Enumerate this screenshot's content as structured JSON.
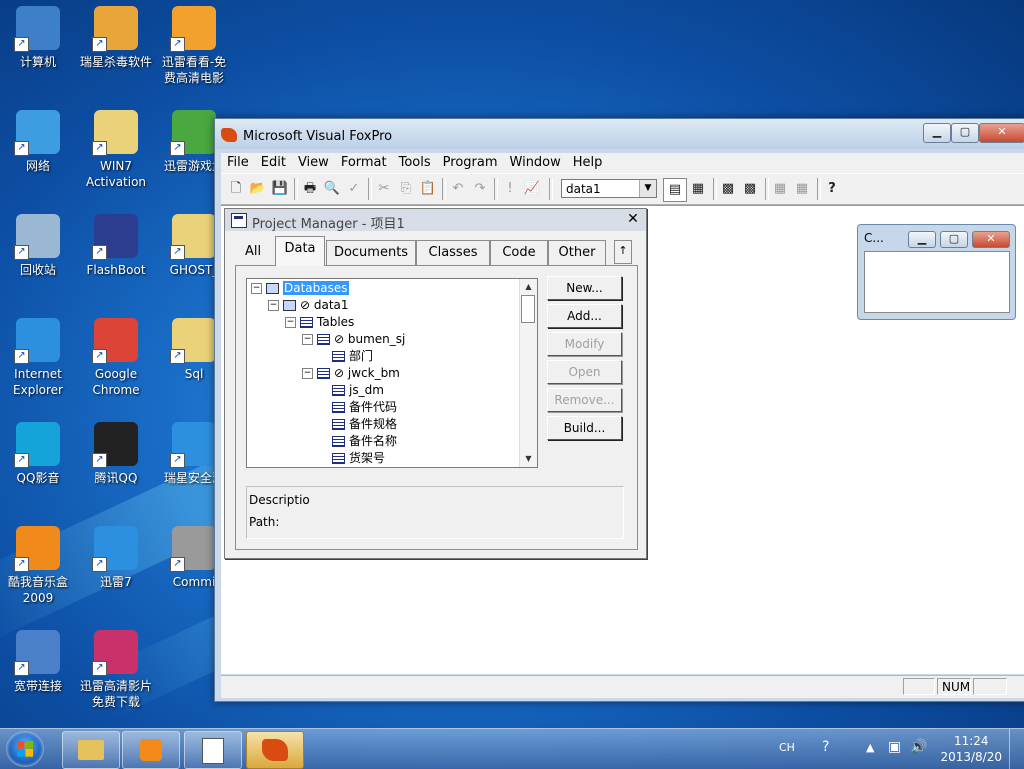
{
  "desktop": {
    "icons": [
      {
        "label": "计算机",
        "color": "#3d7fc9"
      },
      {
        "label": "瑞星杀毒软件",
        "color": "#e8a53a"
      },
      {
        "label": "迅雷看看-免费高清电影",
        "color": "#f2a22c"
      },
      {
        "label": "网络",
        "color": "#3d9de0"
      },
      {
        "label": "WIN7 Activation",
        "color": "#e9d279"
      },
      {
        "label": "迅雷游戏盒",
        "color": "#4aa840"
      },
      {
        "label": "回收站",
        "color": "#9ab8d4"
      },
      {
        "label": "FlashBoot",
        "color": "#2c3d8f"
      },
      {
        "label": "GHOST_",
        "color": "#e9d279"
      },
      {
        "label": "Internet Explorer",
        "color": "#2d8fe0"
      },
      {
        "label": "Google Chrome",
        "color": "#db4437"
      },
      {
        "label": "Sql",
        "color": "#e9d279"
      },
      {
        "label": "QQ影音",
        "color": "#16a3d9"
      },
      {
        "label": "腾讯QQ",
        "color": "#222222"
      },
      {
        "label": "瑞星安全浏",
        "color": "#2d8fe0"
      },
      {
        "label": "酷我音乐盒 2009",
        "color": "#f08a1a"
      },
      {
        "label": "迅雷7",
        "color": "#2d8fe0"
      },
      {
        "label": "Commi",
        "color": "#9a9a9a"
      },
      {
        "label": "宽带连接",
        "color": "#4a7fc9"
      },
      {
        "label": "迅雷高清影片免费下载",
        "color": "#c9316b"
      }
    ]
  },
  "window": {
    "title": "Microsoft Visual FoxPro",
    "menu": [
      "File",
      "Edit",
      "View",
      "Format",
      "Tools",
      "Program",
      "Window",
      "Help"
    ],
    "toolbar_combo": "data1",
    "status": {
      "num": "NUM"
    }
  },
  "project_manager": {
    "title": "Project Manager - 项目1",
    "tabs": [
      "All",
      "Data",
      "Documents",
      "Classes",
      "Code",
      "Other"
    ],
    "active_tab": "Data",
    "tree": [
      {
        "label": "Databases",
        "level": 0,
        "expander": "−",
        "icon": "db",
        "selected": true
      },
      {
        "label": "⊘ data1",
        "level": 1,
        "expander": "−",
        "icon": "db"
      },
      {
        "label": "Tables",
        "level": 2,
        "expander": "−",
        "icon": "table"
      },
      {
        "label": "⊘ bumen_sj",
        "level": 3,
        "expander": "−",
        "icon": "table"
      },
      {
        "label": "部门",
        "level": 4,
        "icon": "field"
      },
      {
        "label": "⊘ jwck_bm",
        "level": 3,
        "expander": "−",
        "icon": "table"
      },
      {
        "label": "js_dm",
        "level": 4,
        "icon": "field"
      },
      {
        "label": "备件代码",
        "level": 4,
        "icon": "field"
      },
      {
        "label": "备件规格",
        "level": 4,
        "icon": "field"
      },
      {
        "label": "备件名称",
        "level": 4,
        "icon": "field"
      },
      {
        "label": "货架号",
        "level": 4,
        "icon": "field"
      }
    ],
    "buttons": [
      {
        "label": "New...",
        "enabled": true
      },
      {
        "label": "Add...",
        "enabled": true
      },
      {
        "label": "Modify",
        "enabled": false
      },
      {
        "label": "Open",
        "enabled": false
      },
      {
        "label": "Remove...",
        "enabled": false
      },
      {
        "label": "Build...",
        "enabled": true
      }
    ],
    "description_label": "Descriptio",
    "path_label": "Path:"
  },
  "mini_window": {
    "title": "C..."
  },
  "taskbar": {
    "tray_lang": "CH",
    "time": "11:24",
    "date": "2013/8/20"
  }
}
